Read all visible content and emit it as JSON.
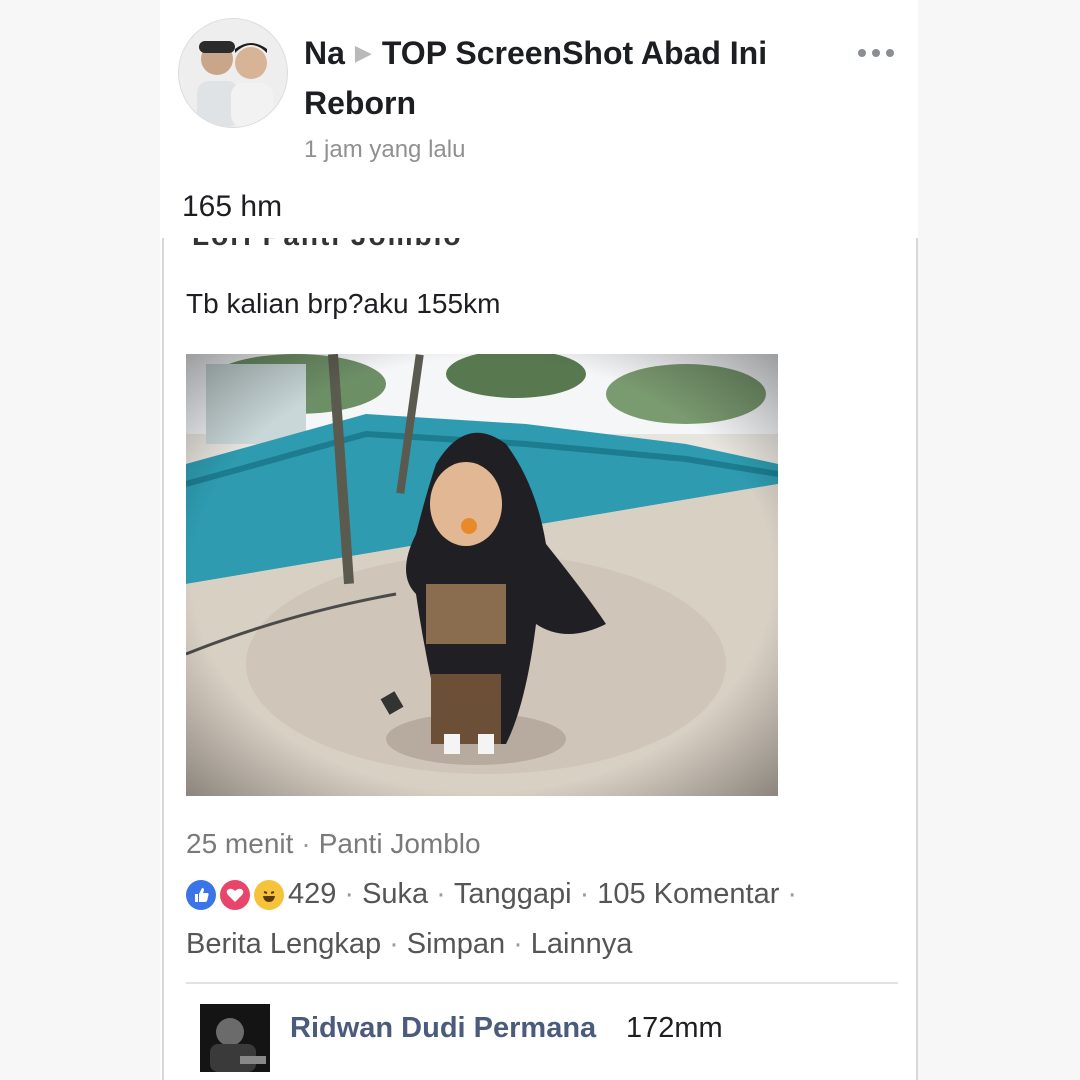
{
  "post": {
    "author": "Na",
    "group": "TOP ScreenShot Abad Ini Reborn",
    "time": "1 jam yang lalu",
    "text": "165 hm"
  },
  "shared_post": {
    "cut_text": "Lori    Panti Jomblo",
    "text": "Tb kalian brp?aku 155km",
    "meta_time": "25 menit",
    "meta_group": "Panti Jomblo",
    "reaction_count": "429",
    "actions": [
      "Suka",
      "Tanggapi",
      "105 Komentar"
    ],
    "links": [
      "Berita Lengkap",
      "Simpan",
      "Lainnya"
    ]
  },
  "comment": {
    "name": "Ridwan Dudi Permana",
    "text": "172mm"
  },
  "colors": {
    "like": "#3b74e6",
    "love": "#e8456b",
    "haha": "#f5c33b",
    "link_name": "#4b5b7c"
  }
}
